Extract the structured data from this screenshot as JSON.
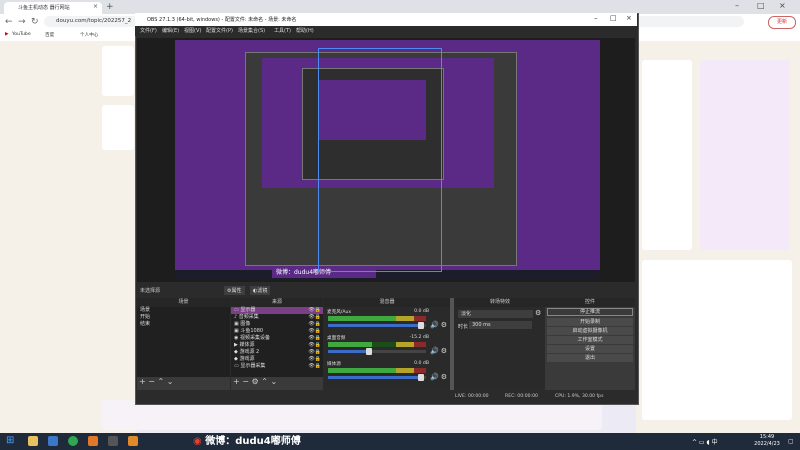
{
  "browser": {
    "tab_title": "斗鱼主机动态 器行网站",
    "url": "douyu.com/topic/202257_2",
    "update_button": "更新",
    "bookmarks": [
      "YouTube",
      "百度",
      "个人中心"
    ]
  },
  "obs": {
    "window_title": "OBS 27.1.3 (64-bit, windows) - 配置文件: 未命名 - 场景: 未命名",
    "menu": [
      "文件(F)",
      "编辑(E)",
      "视图(V)",
      "配置文件(P)",
      "场景集合(S)",
      "工具(T)",
      "帮助(H)"
    ],
    "scene_name_bar": "未选择源",
    "properties_btn": "属性",
    "filters_btn": "滤镜",
    "docks": {
      "scenes": "场景",
      "sources": "来源",
      "mixer": "混音器",
      "transitions": "转场特效",
      "controls": "控件"
    },
    "scenes": [
      "场景",
      "开始",
      "结束"
    ],
    "sources": [
      {
        "label": "显示器",
        "selected": true
      },
      {
        "label": "音频采集",
        "selected": false
      },
      {
        "label": "图像",
        "selected": false
      },
      {
        "label": "斗鱼1080",
        "selected": false
      },
      {
        "label": "视频采集设备",
        "selected": false
      },
      {
        "label": "媒体源",
        "selected": false
      },
      {
        "label": "游戏源 2",
        "selected": false
      },
      {
        "label": "游戏源",
        "selected": false
      },
      {
        "label": "显示器采集",
        "selected": false
      }
    ],
    "mixer": [
      {
        "label": "麦克风/Aux",
        "db": "0.0 dB",
        "level": 0.72,
        "volume": 0.95
      },
      {
        "label": "桌面音频",
        "db": "-15.2 dB",
        "level": 0.45,
        "volume": 0.42
      },
      {
        "label": "媒体源",
        "db": "0.0 dB",
        "level": 0.75,
        "volume": 0.95
      }
    ],
    "transitions": {
      "type": "淡化",
      "duration_label": "时长",
      "duration_value": "300 ms"
    },
    "controls": [
      "停止推流",
      "开始录制",
      "启动虚拟摄像机",
      "工作室模式",
      "设置",
      "退出"
    ],
    "status": {
      "live": "LIVE: 00:00:00",
      "rec": "REC: 00:00:00",
      "cpu": "CPU: 1.9%, 30.00 fps"
    }
  },
  "capture": {
    "caption": "微博：dudu4嘟师傅"
  },
  "taskbar": {
    "watermark": "微博：dudu4嘟师傅",
    "time": "15:49",
    "date": "2022/4/23"
  },
  "colors": {
    "purple": "#5b2a86",
    "selection": "#7a3f87",
    "meter_green": "#3fa93f",
    "volume_blue": "#3a6cc8"
  }
}
